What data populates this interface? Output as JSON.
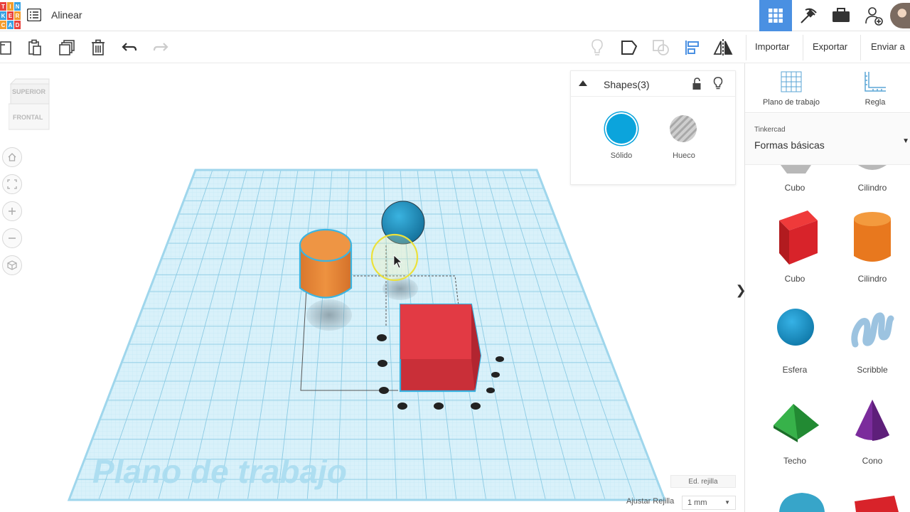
{
  "app": {
    "logo_letters": [
      "T",
      "I",
      "N",
      "K",
      "E",
      "R",
      "C",
      "A",
      "D"
    ],
    "logo_colors": [
      "#e8413c",
      "#f39c2c",
      "#3aa3e3",
      "#e8413c",
      "#f39c2c",
      "#3aa3e3",
      "#e8413c",
      "#f39c2c",
      "#3aa3e3"
    ],
    "design_title": "Alinear",
    "accent_color": "#4a90e2"
  },
  "topbar": {
    "icons": [
      "grid-view-icon",
      "pickaxe-icon",
      "briefcase-icon",
      "add-user-icon"
    ],
    "active_icon": "grid-view-icon"
  },
  "toolbar": {
    "left_icons": [
      "new-icon",
      "paste-icon",
      "duplicate-icon",
      "delete-icon",
      "undo-icon",
      "redo-icon"
    ],
    "right_icons": [
      "light-bulb-icon",
      "group-icon",
      "ungroup-icon",
      "align-icon",
      "mirror-icon"
    ],
    "import_label": "Importar",
    "export_label": "Exportar",
    "send_label": "Enviar a"
  },
  "viewcube": {
    "top_label": "SUPERIOR",
    "front_label": "FRONTAL"
  },
  "view_controls": [
    "home-view-icon",
    "fit-view-icon",
    "zoom-in-icon",
    "zoom-out-icon",
    "ortho-view-icon"
  ],
  "inspector": {
    "title": "Shapes(3)",
    "solid_label": "Sólido",
    "hole_label": "Hueco",
    "solid_color": "#0ba4dc",
    "hole_color": "#bdbdbd"
  },
  "workplane": {
    "watermark": "Plano de trabajo",
    "grid_color": "#a8dcef",
    "edit_grid_label": "Ed. rejilla",
    "snap_grid_label": "Ajustar Rejilla",
    "snap_grid_value": "1 mm"
  },
  "scene_objects": [
    {
      "name": "Cilindro",
      "color": "#e8883a"
    },
    {
      "name": "Esfera",
      "color": "#1a98c8"
    },
    {
      "name": "Cubo",
      "color": "#e03a42"
    }
  ],
  "shapes_panel": {
    "workplane_tool": "Plano de trabajo",
    "ruler_tool": "Regla",
    "library_small": "Tinkercad",
    "library_name": "Formas básicas",
    "partial_row": [
      "Cubo",
      "Cilindro"
    ],
    "items": [
      {
        "label": "Cubo",
        "icon": "red-box-icon",
        "color": "#d8232a"
      },
      {
        "label": "Cilindro",
        "icon": "orange-cylinder-icon",
        "color": "#e8781e"
      },
      {
        "label": "Esfera",
        "icon": "blue-sphere-icon",
        "color": "#1496cf"
      },
      {
        "label": "Scribble",
        "icon": "scribble-icon",
        "color": "#8fb8d8"
      },
      {
        "label": "Techo",
        "icon": "green-roof-icon",
        "color": "#2a9a3a"
      },
      {
        "label": "Cono",
        "icon": "purple-cone-icon",
        "color": "#7b2c9c"
      }
    ]
  }
}
